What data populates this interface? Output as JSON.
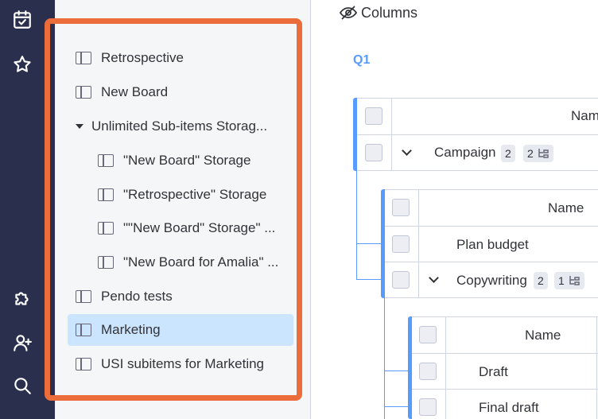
{
  "rail": {
    "icons": [
      "calendar-check-icon",
      "star-icon",
      "puzzle-icon",
      "add-user-icon",
      "search-icon"
    ]
  },
  "sidebar": {
    "items": [
      {
        "label": "Retrospective"
      },
      {
        "label": "New Board"
      },
      {
        "label": "Unlimited Sub-items Storag..."
      },
      {
        "label": "\"New Board\" Storage"
      },
      {
        "label": "\"Retrospective\" Storage"
      },
      {
        "label": "\"\"New Board\" Storage\" ..."
      },
      {
        "label": "\"New Board for Amalia\" ..."
      },
      {
        "label": "Pendo tests"
      },
      {
        "label": "Marketing"
      },
      {
        "label": "USI subitems for Marketing"
      }
    ],
    "selected": "Marketing",
    "highlight_color": "#ec6d3c"
  },
  "main": {
    "columns_label": "Columns",
    "group_title": "Q1",
    "level1": {
      "header_name": "Nam",
      "row": {
        "name": "Campaign",
        "count": "2",
        "subitems": "2"
      }
    },
    "level2": {
      "header_name": "Name",
      "rows": [
        {
          "name": "Plan budget"
        },
        {
          "name": "Copywriting",
          "count": "2",
          "subitems": "1"
        }
      ]
    },
    "level3": {
      "header_name": "Name",
      "rows": [
        {
          "name": "Draft"
        },
        {
          "name": "Final draft"
        }
      ]
    },
    "accent_color": "#579bfc"
  }
}
